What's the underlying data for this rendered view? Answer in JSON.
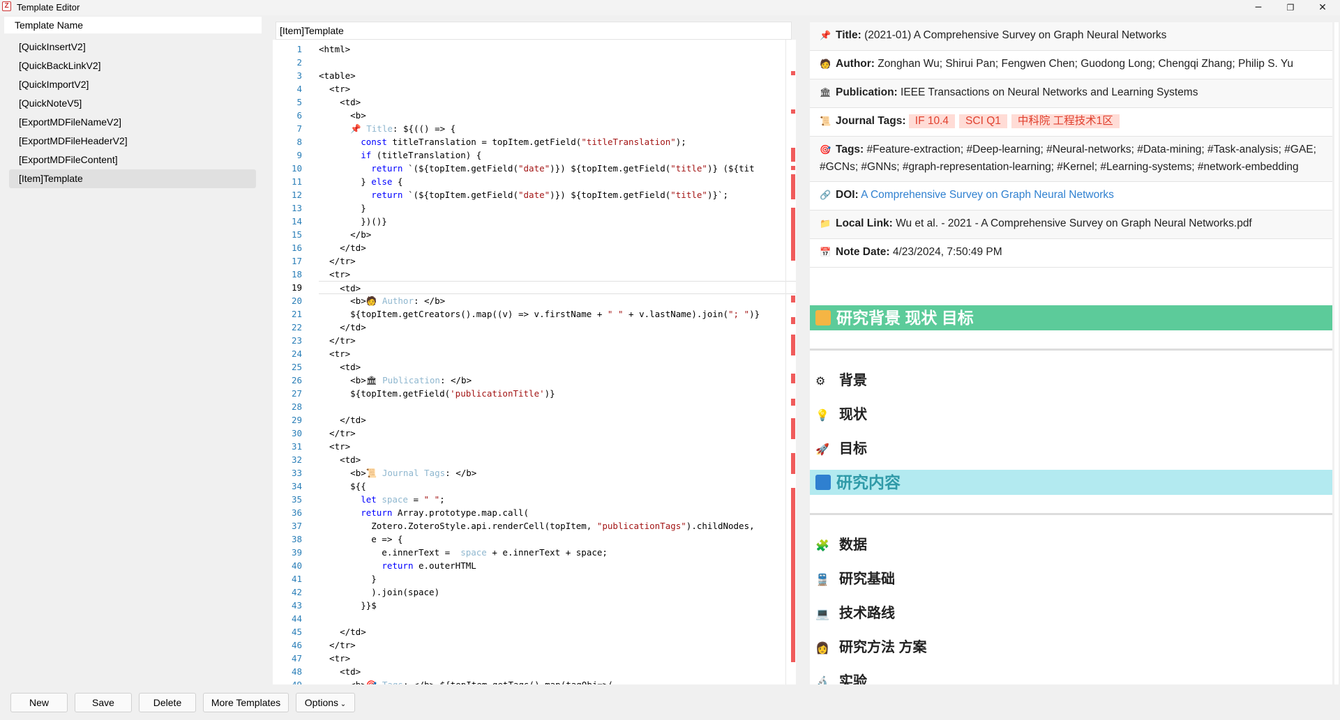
{
  "window": {
    "title": "Template Editor",
    "logo": "Z",
    "minimize": "─",
    "restore": "❐",
    "close": "✕"
  },
  "sidebar": {
    "header": "Template Name",
    "items": [
      "[QuickInsertV2]",
      "[QuickBackLinkV2]",
      "[QuickImportV2]",
      "[QuickNoteV5]",
      "[ExportMDFileNameV2]",
      "[ExportMDFileHeaderV2]",
      "[ExportMDFileContent]",
      "[Item]Template"
    ],
    "selected": "[Item]Template"
  },
  "editor": {
    "tab": "[Item]Template",
    "current_line": 19,
    "lines": [
      "<html>",
      "",
      "<table>",
      "  <tr>",
      "    <td>",
      "      <b>",
      "      📌 Title: ${(() => {",
      "        const titleTranslation = topItem.getField(\"titleTranslation\");",
      "        if (titleTranslation) {",
      "          return `(${topItem.getField(\"date\")}) ${topItem.getField(\"title\")} (${tit",
      "        } else {",
      "          return `(${topItem.getField(\"date\")}) ${topItem.getField(\"title\")}`;",
      "        }",
      "        })()}",
      "      </b>",
      "    </td>",
      "  </tr>",
      "  <tr>",
      "    <td>",
      "      <b>🧑 Author: </b>",
      "      ${topItem.getCreators().map((v) => v.firstName + \" \" + v.lastName).join(\"; \")}",
      "    </td>",
      "  </tr>",
      "  <tr>",
      "    <td>",
      "      <b>🏛 Publication: </b>",
      "      ${topItem.getField('publicationTitle')}",
      "",
      "    </td>",
      "  </tr>",
      "  <tr>",
      "    <td>",
      "      <b>📜 Journal Tags: </b>",
      "      ${{",
      "        let space = \" \";",
      "        return Array.prototype.map.call(",
      "          Zotero.ZoteroStyle.api.renderCell(topItem, \"publicationTags\").childNodes,",
      "          e => {",
      "            e.innerText =  space + e.innerText + space;",
      "            return e.outerHTML",
      "          }",
      "          ).join(space)",
      "        }}$",
      "",
      "    </td>",
      "  </tr>",
      "  <tr>",
      "    <td>",
      "      <b>🎯 Tags: </b> ${topItem.getTags().map(tagObj=>("
    ]
  },
  "preview": {
    "title": {
      "icon": "📌",
      "label": "Title:",
      "value": "(2021-01) A Comprehensive Survey on Graph Neural Networks"
    },
    "author": {
      "icon": "🧑",
      "label": "Author:",
      "value": "Zonghan Wu; Shirui Pan; Fengwen Chen; Guodong Long; Chengqi Zhang; Philip S. Yu"
    },
    "publication": {
      "icon": "🏛",
      "label": "Publication:",
      "value": "IEEE Transactions on Neural Networks and Learning Systems"
    },
    "journal_tags": {
      "icon": "📜",
      "label": "Journal Tags:",
      "badges": [
        "IF 10.4",
        "SCI Q1",
        "中科院 工程技术1区"
      ]
    },
    "tags": {
      "icon": "🎯",
      "label": "Tags:",
      "value": "#Feature-extraction; #Deep-learning; #Neural-networks; #Data-mining; #Task-analysis; #GAE; #GCNs; #GNNs; #graph-representation-learning; #Kernel; #Learning-systems; #network-embedding"
    },
    "doi": {
      "icon": "🔗",
      "label": "DOI:",
      "value": "A Comprehensive Survey on Graph Neural Networks"
    },
    "local_link": {
      "icon": "📁",
      "label": "Local Link:",
      "value": "Wu et al. - 2021 - A Comprehensive Survey on Graph Neural Networks.pdf"
    },
    "note_date": {
      "icon": "📅",
      "label": "Note Date:",
      "value": "4/23/2024, 7:50:49 PM"
    },
    "section1": {
      "title": "研究背景 现状 目标",
      "color": "#5ccb9a",
      "icon_color": "#f5b544"
    },
    "section1_items": [
      {
        "icon": "⚙",
        "label": "背景"
      },
      {
        "icon": "💡",
        "label": "现状"
      },
      {
        "icon": "🚀",
        "label": "目标"
      }
    ],
    "section2": {
      "title": "研究内容",
      "color": "#b3eaf0",
      "icon_color": "#2f80d0"
    },
    "section2_items": [
      {
        "icon": "🧩",
        "label": "数据"
      },
      {
        "icon": "🚆",
        "label": "研究基础"
      },
      {
        "icon": "💻",
        "label": "技术路线"
      },
      {
        "icon": "👩",
        "label": "研究方法 方案"
      },
      {
        "icon": "🔬",
        "label": "实验"
      }
    ]
  },
  "buttons": {
    "new": "New",
    "save": "Save",
    "delete": "Delete",
    "more": "More Templates",
    "options": "Options"
  }
}
